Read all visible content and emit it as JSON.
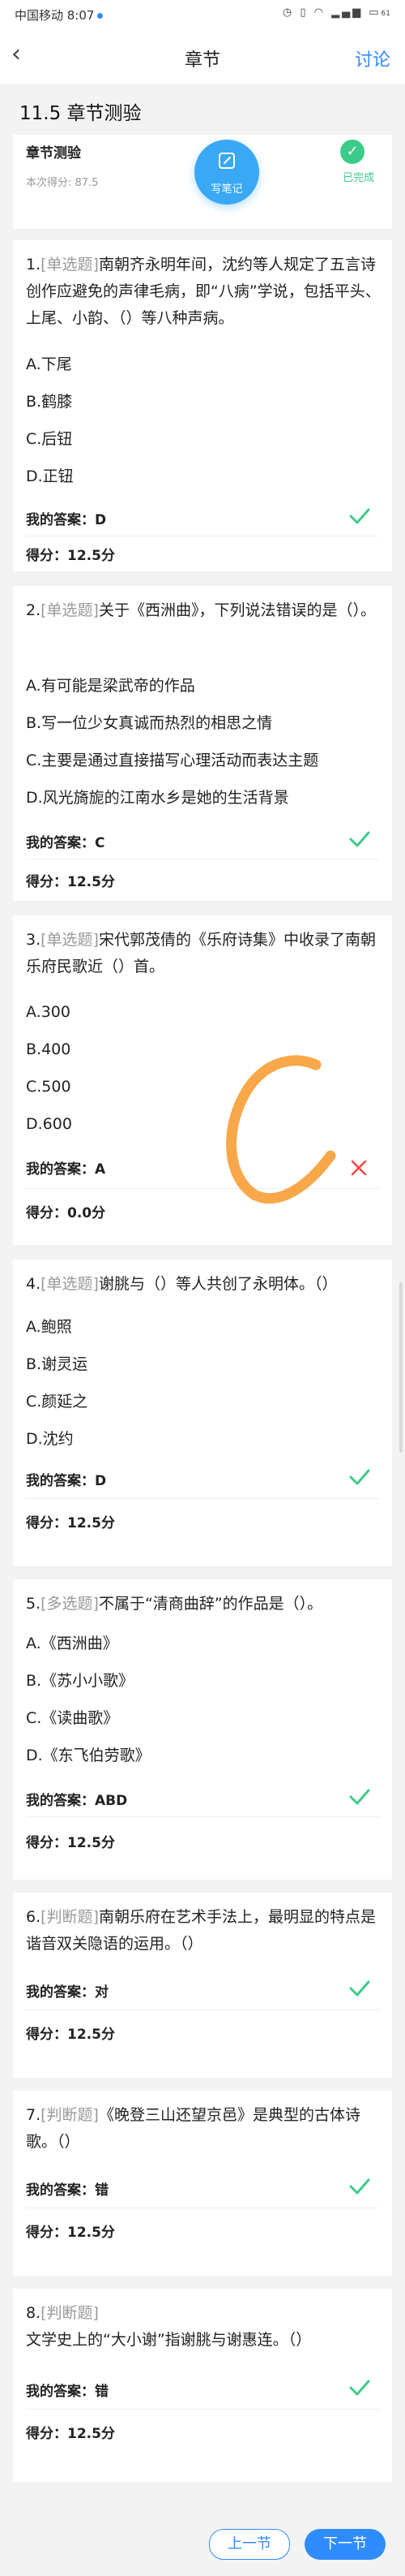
{
  "status_bar": {
    "carrier_time": "中国移动 8:07",
    "icons": [
      "alarm-icon",
      "vibrate-icon",
      "wifi-icon",
      "signal-icon",
      "battery-icon"
    ],
    "battery": "61"
  },
  "nav": {
    "back_icon": "chevron-left-icon",
    "title": "章节",
    "discuss": "讨论"
  },
  "section_title": "11.5 章节测验",
  "header": {
    "name": "章节测验",
    "score": "本次得分: 87.5",
    "note_label": "写笔记",
    "status": "已完成"
  },
  "questions": [
    {
      "number": "1.",
      "type": "[单选题]",
      "text": "南朝齐永明年间，沈约等人规定了五言诗创作应避免的声律毛病，即“八病”学说，包括平头、上尾、小韵、（）等八种声病。",
      "options": [
        "A.下尾",
        "B.鹤膝",
        "C.后钮",
        "D.正钮"
      ],
      "my_answer_label": "我的答案：",
      "my_answer": "D",
      "score_label": "得分：",
      "score": "12.5分",
      "correct": true
    },
    {
      "number": "2.",
      "type": "[单选题]",
      "text": "关于《西洲曲》，下列说法错误的是（）。",
      "options": [
        "A.有可能是梁武帝的作品",
        "B.写一位少女真诚而热烈的相思之情",
        "C.主要是通过直接描写心理活动而表达主题",
        "D.风光旖旎的江南水乡是她的生活背景"
      ],
      "my_answer_label": "我的答案：",
      "my_answer": "C",
      "score_label": "得分：",
      "score": "12.5分",
      "correct": true
    },
    {
      "number": "3.",
      "type": "[单选题]",
      "text": "宋代郭茂倩的《乐府诗集》中收录了南朝乐府民歌近（）首。",
      "options": [
        "A.300",
        "B.400",
        "C.500",
        "D.600"
      ],
      "my_answer_label": "我的答案：",
      "my_answer": "A",
      "score_label": "得分：",
      "score": "0.0分",
      "correct": false
    },
    {
      "number": "4.",
      "type": "[单选题]",
      "text": "谢朓与（）等人共创了永明体。（）",
      "options": [
        "A.鲍照",
        "B.谢灵运",
        "C.颜延之",
        "D.沈约"
      ],
      "my_answer_label": "我的答案：",
      "my_answer": "D",
      "score_label": "得分：",
      "score": "12.5分",
      "correct": true
    },
    {
      "number": "5.",
      "type": "[多选题]",
      "text": "不属于“清商曲辞”的作品是（）。",
      "options": [
        "A.《西洲曲》",
        "B.《苏小小歌》",
        "C.《读曲歌》",
        "D.《东飞伯劳歌》"
      ],
      "my_answer_label": "我的答案：",
      "my_answer": "ABD",
      "score_label": "得分：",
      "score": "12.5分",
      "correct": true
    },
    {
      "number": "6.",
      "type": "[判断题]",
      "text": "南朝乐府在艺术手法上，最明显的特点是谐音双关隐语的运用。（）",
      "options": [],
      "my_answer_label": "我的答案：",
      "my_answer": "对",
      "score_label": "得分：",
      "score": "12.5分",
      "correct": true
    },
    {
      "number": "7.",
      "type": "[判断题]",
      "text": "《晚登三山还望京邑》是典型的古体诗歌。（）",
      "options": [],
      "my_answer_label": "我的答案：",
      "my_answer": "错",
      "score_label": "得分：",
      "score": "12.5分",
      "correct": true
    },
    {
      "number": "8.",
      "type": "[判断题]",
      "text": "文学史上的“大小谢”指谢朓与谢惠连。（）",
      "options": [],
      "my_answer_label": "我的答案：",
      "my_answer": "错",
      "score_label": "得分：",
      "score": "12.5分",
      "correct": true
    }
  ],
  "footer": {
    "prev": "上一节",
    "next": "下一节"
  },
  "colors": {
    "accent": "#2f8cff",
    "correct": "#3bcc8a",
    "wrong": "#f04848",
    "note_button": "#3aa8f5",
    "scribble": "#f7a13a"
  }
}
